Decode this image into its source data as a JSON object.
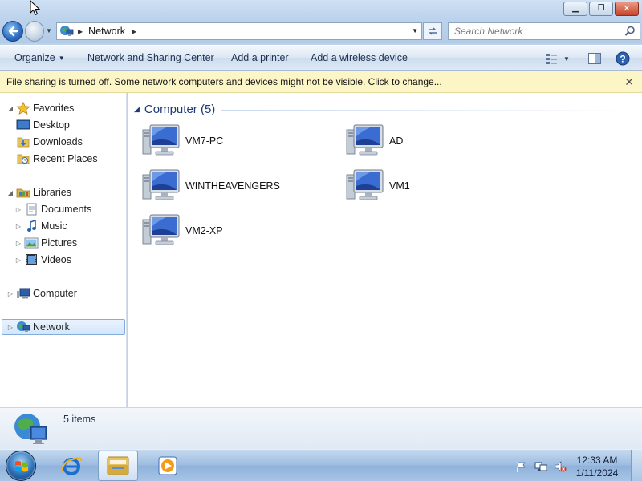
{
  "window": {
    "minimize_glyph": "▁",
    "maximize_glyph": "❐",
    "close_glyph": "✕"
  },
  "address": {
    "location_icon": "network-icon",
    "crumb": "Network"
  },
  "search": {
    "placeholder": "Search Network"
  },
  "commands": {
    "organize": "Organize",
    "network_sharing": "Network and Sharing Center",
    "add_printer": "Add a printer",
    "add_wireless": "Add a wireless device"
  },
  "infobar": {
    "text": "File sharing is turned off. Some network computers and devices might not be visible. Click to change...",
    "close_glyph": "✕"
  },
  "navpane": {
    "favorites": "Favorites",
    "desktop": "Desktop",
    "downloads": "Downloads",
    "recent_places": "Recent Places",
    "libraries": "Libraries",
    "documents": "Documents",
    "music": "Music",
    "pictures": "Pictures",
    "videos": "Videos",
    "computer": "Computer",
    "network": "Network"
  },
  "content": {
    "group_title": "Computer (5)",
    "computers": [
      {
        "name": "VM7-PC"
      },
      {
        "name": "AD"
      },
      {
        "name": "WINTHEAVENGERS"
      },
      {
        "name": "VM1"
      },
      {
        "name": "VM2-XP"
      }
    ]
  },
  "details": {
    "count": "5 items"
  },
  "taskbar": {
    "time": "12:33 AM",
    "date": "1/11/2024"
  },
  "colors": {
    "accent": "#1e3a78",
    "infobar_bg": "#fcf6c7",
    "selection": "#d3e6fb"
  }
}
